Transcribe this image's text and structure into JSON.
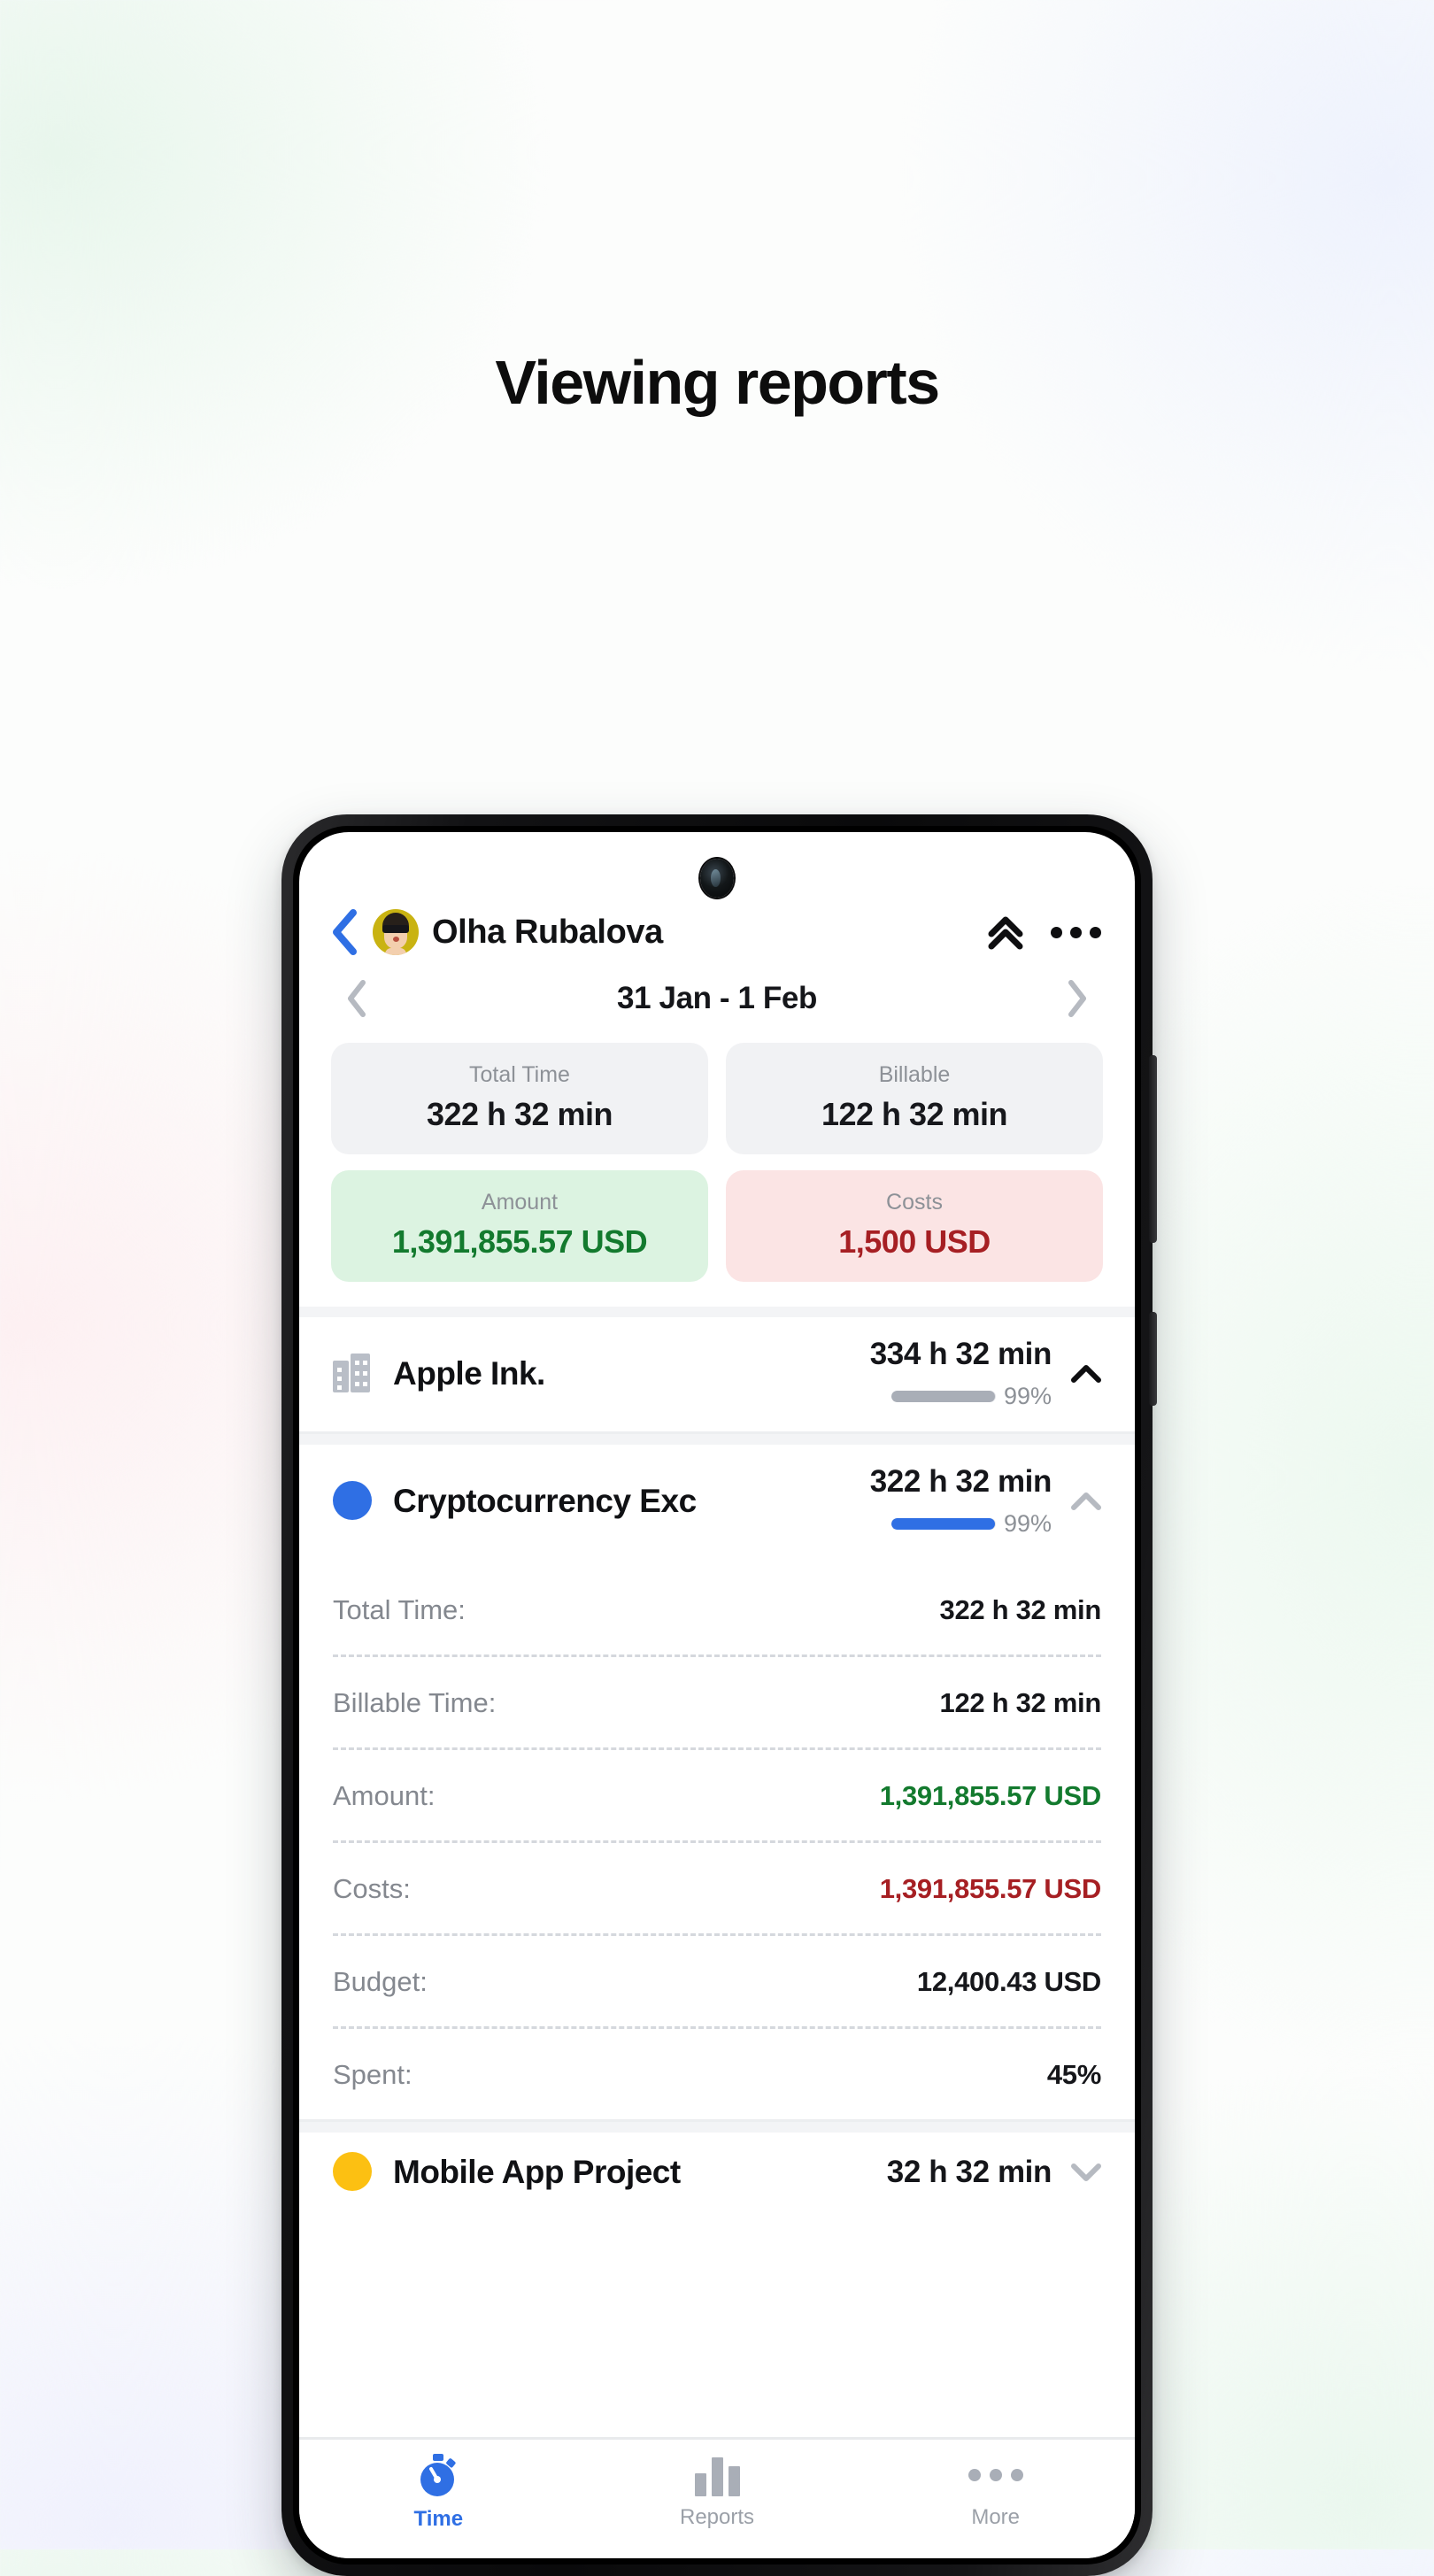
{
  "page": {
    "title": "Viewing reports"
  },
  "device": {
    "camera": "front-camera",
    "buttons": [
      "volume-rocker",
      "power-button"
    ]
  },
  "header": {
    "back_icon": "chevron-left-icon",
    "avatar": "user-avatar",
    "user_name": "Olha Rubalova",
    "collapse_icon": "double-chevron-up-icon",
    "menu_icon": "more-options-icon"
  },
  "date_nav": {
    "prev_icon": "chevron-left-icon",
    "range": "31 Jan - 1 Feb",
    "next_icon": "chevron-right-icon"
  },
  "summary": {
    "cards": [
      {
        "label": "Total Time",
        "value": "322 h 32 min",
        "style": "grey"
      },
      {
        "label": "Billable",
        "value": "122 h 32 min",
        "style": "grey"
      },
      {
        "label": "Amount",
        "value": "1,391,855.57 USD",
        "style": "green"
      },
      {
        "label": "Costs",
        "value": "1,500 USD",
        "style": "red"
      }
    ]
  },
  "projects": [
    {
      "icon": "building-icon",
      "name": "Apple Ink.",
      "time": "334 h 32 min",
      "percent": "99%",
      "percent_value": 99,
      "chevron": "chevron-up-icon",
      "expanded": false
    },
    {
      "icon": "color-dot-blue",
      "name": "Cryptocurrency Exc",
      "time": "322 h 32 min",
      "percent": "99%",
      "percent_value": 99,
      "chevron": "chevron-up-icon",
      "expanded": true
    },
    {
      "icon": "color-dot-yellow",
      "name": "Mobile App Project",
      "time": "32 h 32 min",
      "percent": "",
      "percent_value": 0,
      "chevron": "chevron-down-icon",
      "expanded": false
    }
  ],
  "details": [
    {
      "label": "Total Time:",
      "value": "322 h 32 min",
      "tone": "dark"
    },
    {
      "label": "Billable Time:",
      "value": "122 h 32 min",
      "tone": "dark"
    },
    {
      "label": "Amount:",
      "value": "1,391,855.57 USD",
      "tone": "green"
    },
    {
      "label": "Costs:",
      "value": "1,391,855.57 USD",
      "tone": "red"
    },
    {
      "label": "Budget:",
      "value": "12,400.43 USD",
      "tone": "dark"
    },
    {
      "label": "Spent:",
      "value": "45%",
      "tone": "dark"
    }
  ],
  "tabbar": {
    "tabs": [
      {
        "label": "Time",
        "icon": "stopwatch-icon",
        "active": true
      },
      {
        "label": "Reports",
        "icon": "bar-chart-icon",
        "active": false
      },
      {
        "label": "More",
        "icon": "more-dots-icon",
        "active": false
      }
    ]
  },
  "colors": {
    "accent_blue": "#2f6fe4",
    "green_text": "#137a2e",
    "green_bg": "#dcf3e1",
    "red_text": "#a61f23",
    "red_bg": "#fbe4e4",
    "grey_bg": "#f1f2f4",
    "muted": "#8d9197",
    "yellow": "#fcc012"
  }
}
